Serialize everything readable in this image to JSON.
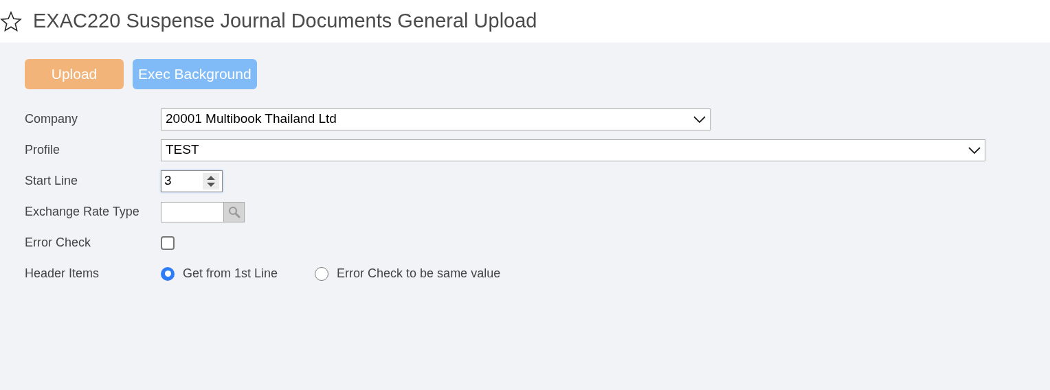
{
  "header": {
    "title": "EXAC220 Suspense Journal Documents General Upload",
    "favorite": false
  },
  "buttons": [
    {
      "label": "Upload",
      "kind": "primary"
    },
    {
      "label": "Exec Background",
      "kind": "secondary"
    }
  ],
  "fields": [
    {
      "label": "Company",
      "kind": "select",
      "value": "20001 Multibook Thailand Ltd"
    },
    {
      "label": "Profile",
      "kind": "select",
      "value": "TEST"
    },
    {
      "label": "Start Line",
      "kind": "number",
      "value": "3"
    },
    {
      "label": "Exchange Rate Type",
      "kind": "lookup"
    },
    {
      "label": "Error Check",
      "kind": "checkbox",
      "checked": false
    },
    {
      "label": "Header Items",
      "kind": "radio",
      "options": [
        {
          "label": "Get from 1st Line",
          "selected": true
        },
        {
          "label": "Error Check to be same value",
          "selected": false
        }
      ]
    }
  ]
}
